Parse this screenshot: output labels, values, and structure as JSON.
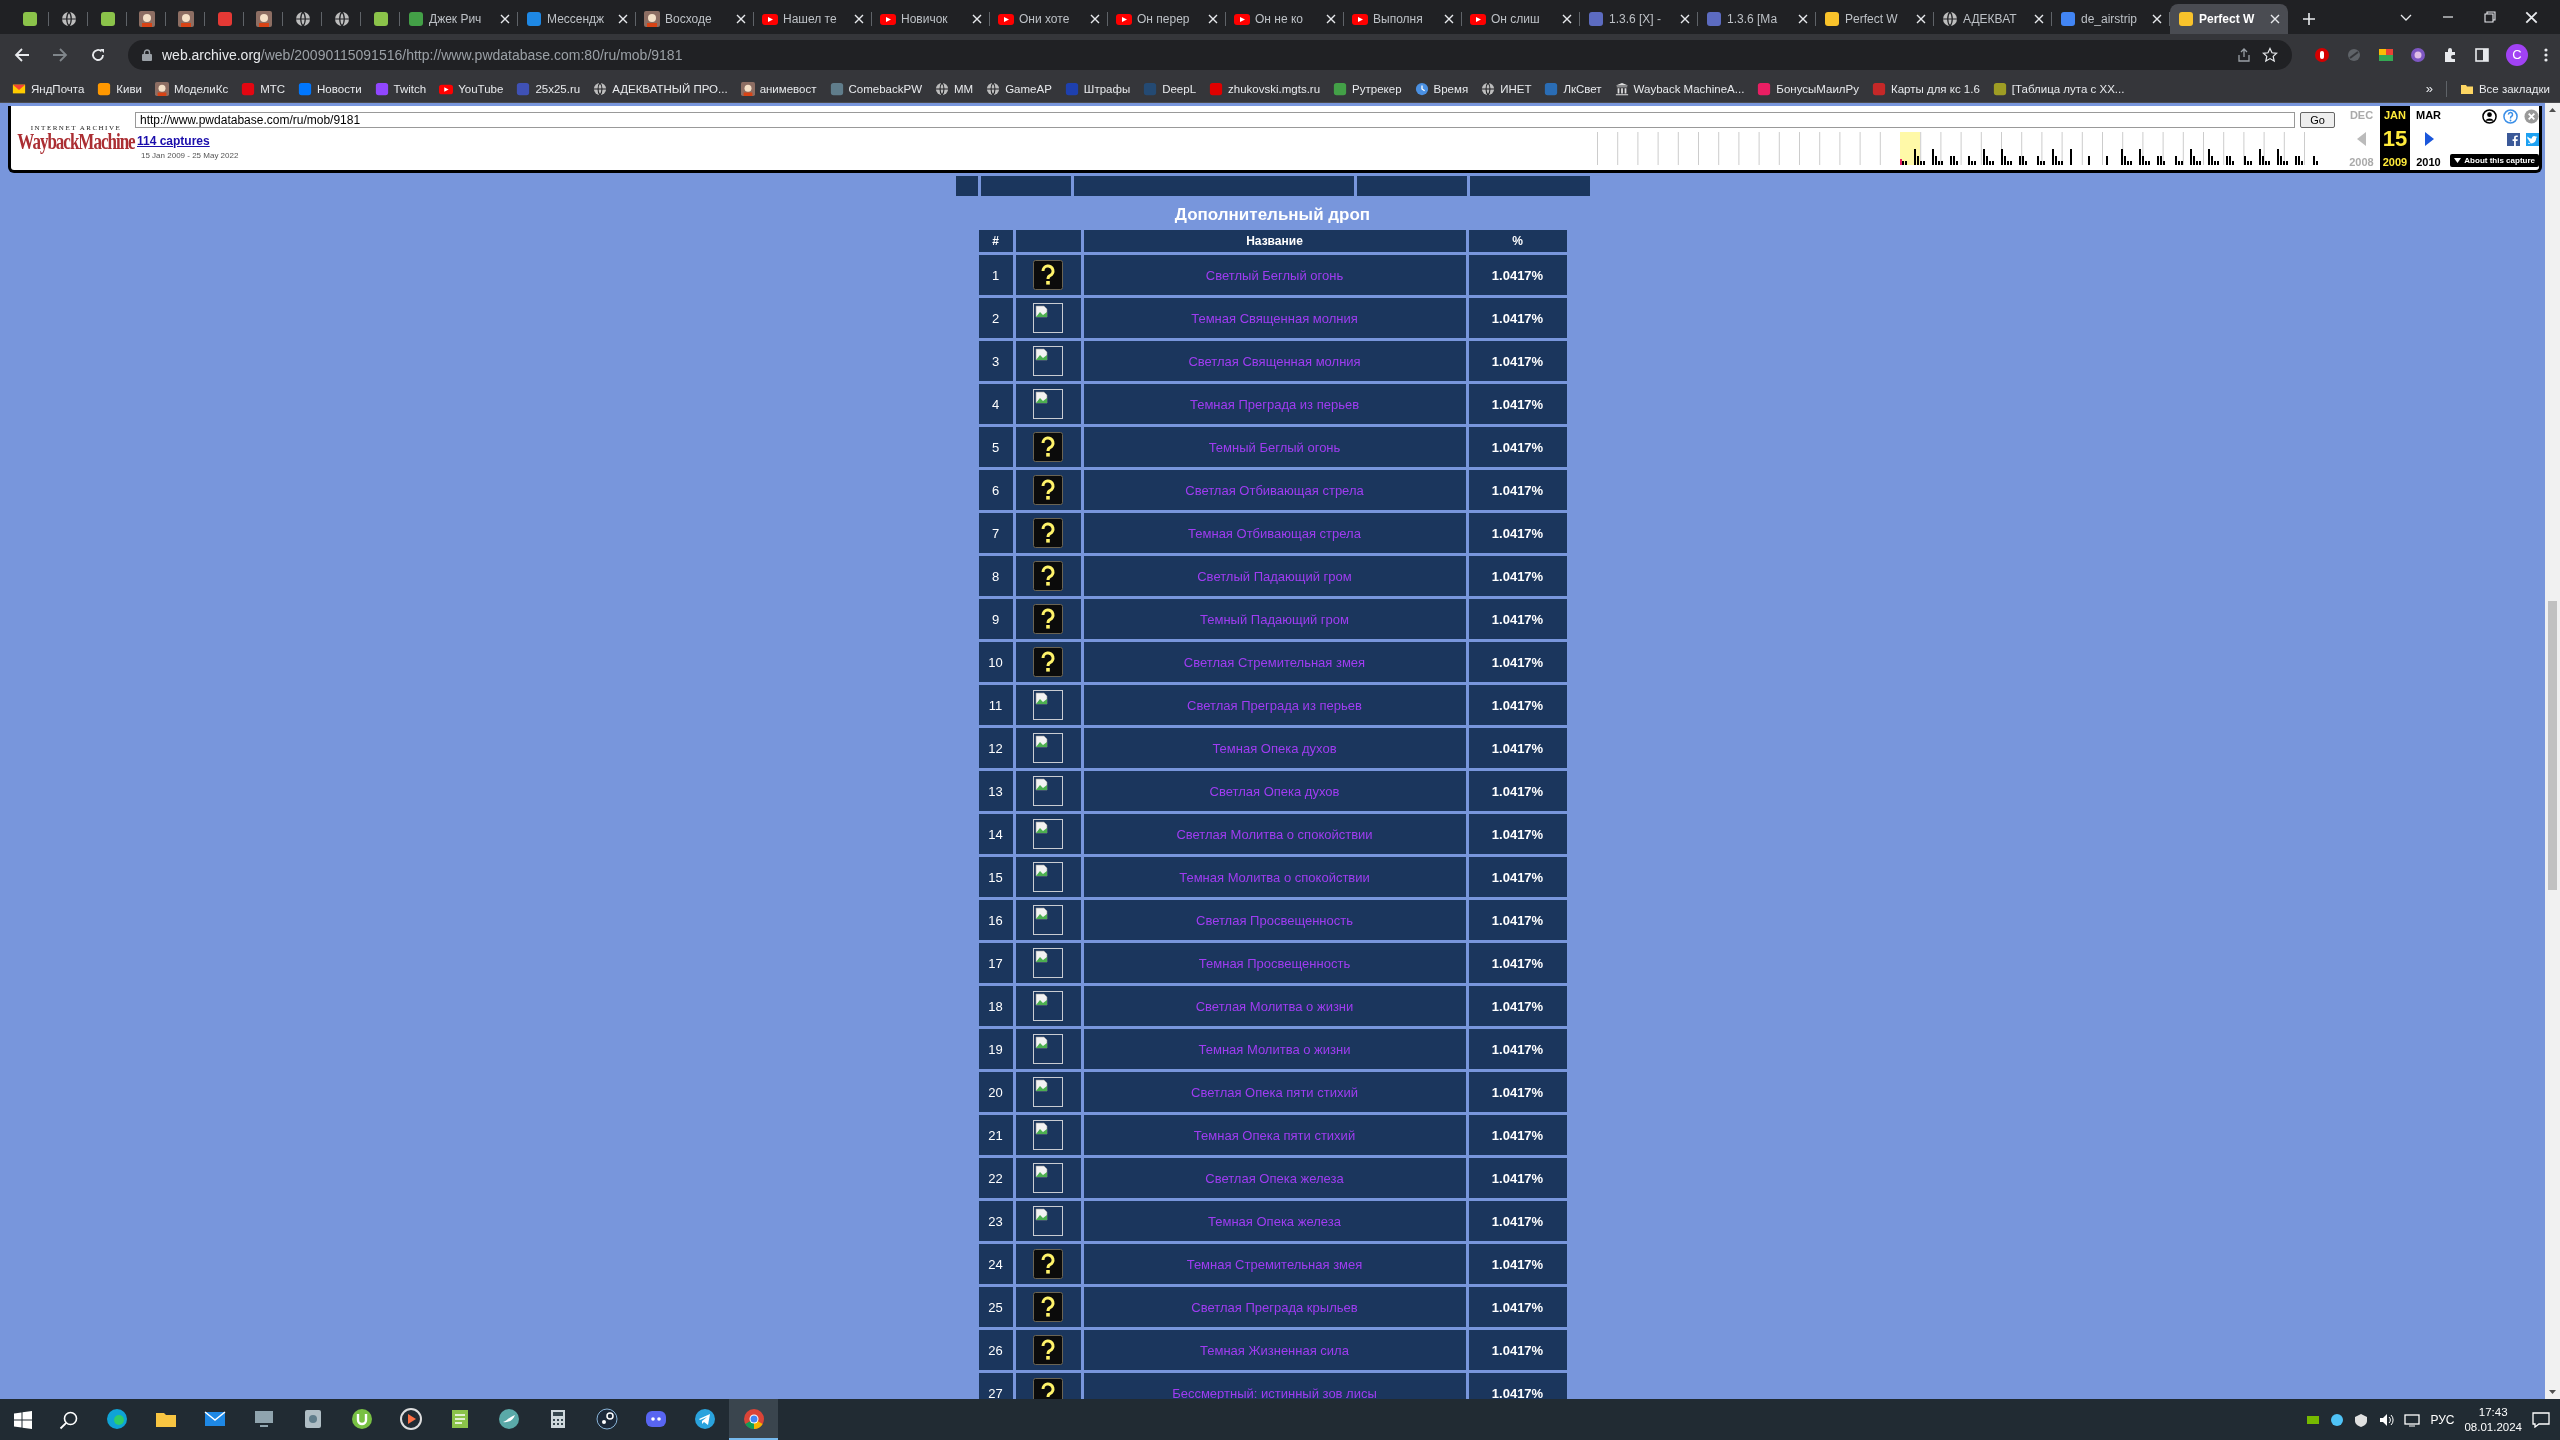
{
  "browser": {
    "tabs": [
      {
        "kind": "green",
        "selected": false
      },
      {
        "kind": "globe",
        "selected": false
      },
      {
        "kind": "green",
        "selected": false
      },
      {
        "kind": "avatar",
        "selected": false
      },
      {
        "kind": "avatar",
        "selected": false
      },
      {
        "kind": "red",
        "selected": false
      },
      {
        "kind": "avatar",
        "selected": false
      },
      {
        "kind": "globe",
        "selected": false
      },
      {
        "kind": "globe",
        "selected": false
      },
      {
        "kind": "green",
        "selected": false
      },
      {
        "kind": "hd",
        "title": "Джек Рич",
        "selected": false
      },
      {
        "kind": "chat",
        "title": "Мессендж",
        "selected": false
      },
      {
        "kind": "avatar",
        "title": "Восходе",
        "selected": false
      },
      {
        "kind": "play",
        "title": "Нашел те",
        "selected": false
      },
      {
        "kind": "play",
        "title": "Новичок",
        "selected": false
      },
      {
        "kind": "play",
        "title": "Они хоте",
        "selected": false
      },
      {
        "kind": "play",
        "title": "Он перер",
        "selected": false
      },
      {
        "kind": "play",
        "title": "Он не ко",
        "selected": false
      },
      {
        "kind": "play",
        "title": "Выполня",
        "selected": false
      },
      {
        "kind": "play",
        "title": "Он слиш",
        "selected": false
      },
      {
        "kind": "game",
        "title": "1.3.6 [X] -",
        "selected": false
      },
      {
        "kind": "game",
        "title": "1.3.6 [Ма",
        "selected": false
      },
      {
        "kind": "pw",
        "title": "Perfect W",
        "selected": false
      },
      {
        "kind": "globe",
        "title": "АДЕКВАТ",
        "selected": false
      },
      {
        "kind": "google",
        "title": "de_airstrip",
        "selected": false
      },
      {
        "kind": "pw",
        "title": "Perfect W",
        "selected": true
      }
    ],
    "address": {
      "host": "web.archive.org",
      "path": "/web/20090115091516/http://www.pwdatabase.com:80/ru/mob/9181"
    },
    "profile_initial": "C",
    "bookmarks": [
      {
        "kind": "mail",
        "label": "ЯндПочта"
      },
      {
        "kind": "q",
        "label": "Киви"
      },
      {
        "kind": "avatar",
        "label": "МоделиКс"
      },
      {
        "kind": "mts",
        "label": "МТС"
      },
      {
        "kind": "vk",
        "label": "Новости"
      },
      {
        "kind": "twitch",
        "label": "Twitch"
      },
      {
        "kind": "play",
        "label": "YouTube"
      },
      {
        "kind": "g",
        "label": "25x25.ru"
      },
      {
        "kind": "globe",
        "label": "АДЕКВАТНЫЙ ПРО..."
      },
      {
        "kind": "avatar",
        "label": "анимевост"
      },
      {
        "kind": "pwb",
        "label": "ComebackPW"
      },
      {
        "kind": "globe",
        "label": "MM"
      },
      {
        "kind": "globe",
        "label": "GameAP"
      },
      {
        "kind": "flag",
        "label": "Штрафы"
      },
      {
        "kind": "deepl",
        "label": "DeepL"
      },
      {
        "kind": "drop",
        "label": "zhukovski.mgts.ru"
      },
      {
        "kind": "star",
        "label": "Рутрекер"
      },
      {
        "kind": "clock",
        "label": "Время"
      },
      {
        "kind": "globe",
        "label": "ИНЕТ"
      },
      {
        "kind": "site",
        "label": "ЛкСвет"
      },
      {
        "kind": "archive",
        "label": "Wayback MachineA..."
      },
      {
        "kind": "cube",
        "label": "БонусыМаилРу"
      },
      {
        "kind": "cards",
        "label": "Карты для кс 1.6"
      },
      {
        "kind": "table",
        "label": "[Таблица лута с XX..."
      }
    ],
    "bookmarks_more": "»",
    "all_bookmarks": "Все закладки"
  },
  "wayback": {
    "logo_top": "INTERNET ARCHIVE",
    "logo": "WaybackMachine",
    "url": "http://www.pwdatabase.com/ru/mob/9181",
    "go": "Go",
    "captures": "114 captures",
    "range": "15 Jan 2009 - 25 May 2022",
    "calendar": {
      "prev_month": "DEC",
      "month": "JAN",
      "next_month": "MAR",
      "prev_year": "2008",
      "day": "15",
      "year": "2009",
      "next_year": "2010"
    },
    "about": "About this capture"
  },
  "page": {
    "title": "Дополнительный дроп",
    "columns": {
      "number": "#",
      "name": "Название",
      "percent": "%"
    },
    "rows": [
      {
        "number": "1",
        "kind": "question",
        "name": "Светлый Беглый огонь",
        "percent": "1.0417%"
      },
      {
        "number": "2",
        "kind": "broken",
        "name": "Темная Священная молния",
        "percent": "1.0417%"
      },
      {
        "number": "3",
        "kind": "broken",
        "name": "Светлая Священная молния",
        "percent": "1.0417%"
      },
      {
        "number": "4",
        "kind": "broken",
        "name": "Темная Преграда из перьев",
        "percent": "1.0417%"
      },
      {
        "number": "5",
        "kind": "question",
        "name": "Темный Беглый огонь",
        "percent": "1.0417%"
      },
      {
        "number": "6",
        "kind": "question",
        "name": "Светлая Отбивающая стрела",
        "percent": "1.0417%"
      },
      {
        "number": "7",
        "kind": "question",
        "name": "Темная Отбивающая стрела",
        "percent": "1.0417%"
      },
      {
        "number": "8",
        "kind": "question",
        "name": "Светлый Падающий гром",
        "percent": "1.0417%"
      },
      {
        "number": "9",
        "kind": "question",
        "name": "Темный Падающий гром",
        "percent": "1.0417%"
      },
      {
        "number": "10",
        "kind": "question",
        "name": "Светлая Стремительная змея",
        "percent": "1.0417%"
      },
      {
        "number": "11",
        "kind": "broken",
        "name": "Светлая Преграда из перьев",
        "percent": "1.0417%"
      },
      {
        "number": "12",
        "kind": "broken",
        "name": "Темная Опека духов",
        "percent": "1.0417%"
      },
      {
        "number": "13",
        "kind": "broken",
        "name": "Светлая Опека духов",
        "percent": "1.0417%"
      },
      {
        "number": "14",
        "kind": "broken",
        "name": "Светлая Молитва о спокойствии",
        "percent": "1.0417%"
      },
      {
        "number": "15",
        "kind": "broken",
        "name": "Темная Молитва о спокойствии",
        "percent": "1.0417%"
      },
      {
        "number": "16",
        "kind": "broken",
        "name": "Светлая Просвещенность",
        "percent": "1.0417%"
      },
      {
        "number": "17",
        "kind": "broken",
        "name": "Темная Просвещенность",
        "percent": "1.0417%"
      },
      {
        "number": "18",
        "kind": "broken",
        "name": "Светлая Молитва о жизни",
        "percent": "1.0417%"
      },
      {
        "number": "19",
        "kind": "broken",
        "name": "Темная Молитва о жизни",
        "percent": "1.0417%"
      },
      {
        "number": "20",
        "kind": "broken",
        "name": "Светлая Опека пяти стихий",
        "percent": "1.0417%"
      },
      {
        "number": "21",
        "kind": "broken",
        "name": "Темная Опека пяти стихий",
        "percent": "1.0417%"
      },
      {
        "number": "22",
        "kind": "broken",
        "name": "Светлая Опека железа",
        "percent": "1.0417%"
      },
      {
        "number": "23",
        "kind": "broken",
        "name": "Темная Опека железа",
        "percent": "1.0417%"
      },
      {
        "number": "24",
        "kind": "question",
        "name": "Темная Стремительная змея",
        "percent": "1.0417%"
      },
      {
        "number": "25",
        "kind": "question",
        "name": "Светлая Преграда крыльев",
        "percent": "1.0417%"
      },
      {
        "number": "26",
        "kind": "question",
        "name": "Темная Жизненная сила",
        "percent": "1.0417%"
      },
      {
        "number": "27",
        "kind": "question",
        "name": "Бессмертный: истинный зов лисы",
        "percent": "1.0417%"
      }
    ]
  },
  "taskbar": {
    "apps": [
      {
        "kind": "edge",
        "selected": false
      },
      {
        "kind": "folder",
        "selected": false
      },
      {
        "kind": "mail",
        "selected": false
      },
      {
        "kind": "monitor",
        "selected": false
      },
      {
        "kind": "disk",
        "selected": false
      },
      {
        "kind": "torrent",
        "selected": false
      },
      {
        "kind": "player",
        "selected": false
      },
      {
        "kind": "notes",
        "selected": false
      },
      {
        "kind": "bird",
        "selected": false
      },
      {
        "kind": "calc",
        "selected": false
      },
      {
        "kind": "steam",
        "selected": false
      },
      {
        "kind": "discord",
        "selected": false
      },
      {
        "kind": "telegram",
        "selected": false
      },
      {
        "kind": "chrome",
        "selected": true
      }
    ],
    "language": "РУС",
    "time": "17:43",
    "date": "08.01.2024"
  }
}
